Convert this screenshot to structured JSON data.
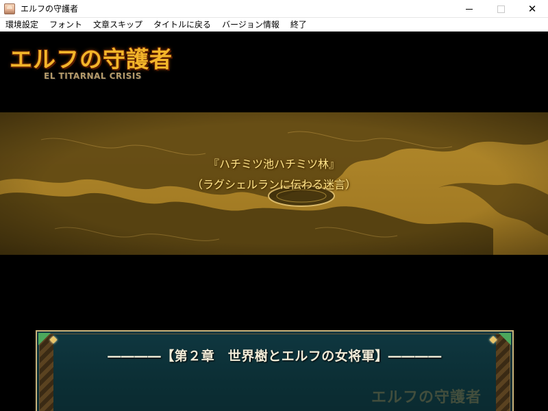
{
  "window": {
    "title": "エルフの守護者",
    "icon": "app-portrait-icon",
    "controls": {
      "minimize": "minimize-icon",
      "maximize": "maximize-icon",
      "close_glyph": "✕"
    }
  },
  "menu": {
    "items": [
      "環境設定",
      "フォント",
      "文章スキップ",
      "タイトルに戻る",
      "バージョン情報",
      "終了"
    ]
  },
  "logo": {
    "title": "エルフの守護者",
    "subtitle": "EL TITARNAL CRISIS"
  },
  "banner": {
    "line1": "『ハチミツ池ハチミツ林』",
    "line2": "（ラグシェルランに伝わる迷言）"
  },
  "message": {
    "chapter": "――――【第２章　世界樹とエルフの女将軍】――――",
    "watermark": "エルフの守護者"
  },
  "colors": {
    "banner_tint": "#8a6a1a",
    "banner_text": "#ffe48a",
    "logo_gold": "#f3b52a",
    "message_bg": "#0f3740",
    "frame_gold": "#c9b27a"
  }
}
